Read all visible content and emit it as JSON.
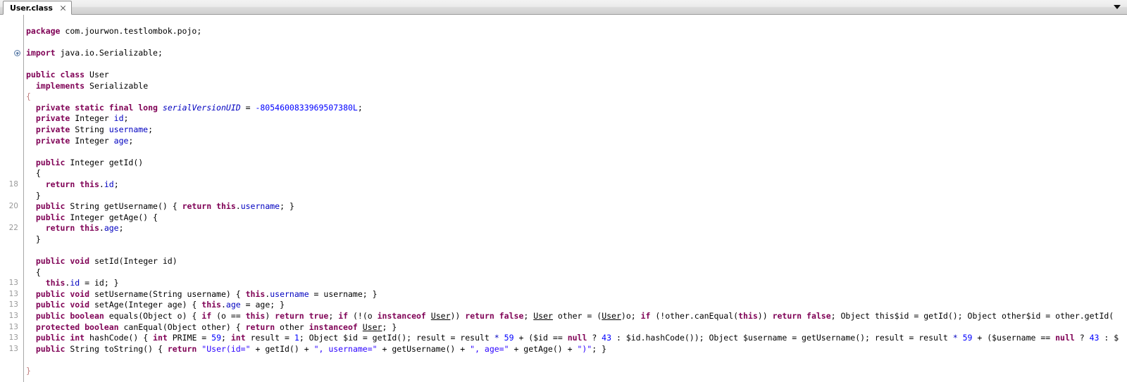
{
  "window": {
    "tab": {
      "label": "User.class",
      "close_icon": "close-icon"
    },
    "tab_menu_icon": "chevron-down-icon"
  },
  "editor": {
    "language": "java",
    "colors": {
      "keyword": "#7f0055",
      "field": "#0000c0",
      "number": "#0000ff",
      "string": "#2a00ff",
      "static_field": "#0000c0",
      "brace_highlight": "#c07f7f",
      "gutter_text": "#999999",
      "background": "#ffffff"
    },
    "lines": [
      {
        "num": "",
        "fold": false,
        "tokens": []
      },
      {
        "num": "",
        "fold": false,
        "tokens": [
          {
            "t": "kw",
            "s": "package"
          },
          {
            "t": "plain",
            "s": " com.jourwon.testlombok.pojo;"
          }
        ]
      },
      {
        "num": "",
        "fold": false,
        "tokens": []
      },
      {
        "num": "",
        "fold": true,
        "tokens": [
          {
            "t": "kw",
            "s": "import"
          },
          {
            "t": "plain",
            "s": " java.io.Serializable;"
          }
        ]
      },
      {
        "num": "",
        "fold": false,
        "tokens": []
      },
      {
        "num": "",
        "fold": false,
        "tokens": [
          {
            "t": "kw",
            "s": "public class"
          },
          {
            "t": "plain",
            "s": " User"
          }
        ]
      },
      {
        "num": "",
        "fold": false,
        "tokens": [
          {
            "t": "plain",
            "s": "  "
          },
          {
            "t": "kw",
            "s": "implements"
          },
          {
            "t": "plain",
            "s": " Serializable"
          }
        ]
      },
      {
        "num": "",
        "fold": false,
        "tokens": [
          {
            "t": "rbrace",
            "s": "{"
          }
        ]
      },
      {
        "num": "",
        "fold": false,
        "tokens": [
          {
            "t": "plain",
            "s": "  "
          },
          {
            "t": "kw",
            "s": "private static final long"
          },
          {
            "t": "plain",
            "s": " "
          },
          {
            "t": "stat",
            "s": "serialVersionUID"
          },
          {
            "t": "plain",
            "s": " = "
          },
          {
            "t": "num",
            "s": "-8054600833969507380L"
          },
          {
            "t": "plain",
            "s": ";"
          }
        ]
      },
      {
        "num": "",
        "fold": false,
        "tokens": [
          {
            "t": "plain",
            "s": "  "
          },
          {
            "t": "kw",
            "s": "private"
          },
          {
            "t": "plain",
            "s": " Integer "
          },
          {
            "t": "fld",
            "s": "id"
          },
          {
            "t": "plain",
            "s": ";"
          }
        ]
      },
      {
        "num": "",
        "fold": false,
        "tokens": [
          {
            "t": "plain",
            "s": "  "
          },
          {
            "t": "kw",
            "s": "private"
          },
          {
            "t": "plain",
            "s": " String "
          },
          {
            "t": "fld",
            "s": "username"
          },
          {
            "t": "plain",
            "s": ";"
          }
        ]
      },
      {
        "num": "",
        "fold": false,
        "tokens": [
          {
            "t": "plain",
            "s": "  "
          },
          {
            "t": "kw",
            "s": "private"
          },
          {
            "t": "plain",
            "s": " Integer "
          },
          {
            "t": "fld",
            "s": "age"
          },
          {
            "t": "plain",
            "s": ";"
          }
        ]
      },
      {
        "num": "",
        "fold": false,
        "tokens": []
      },
      {
        "num": "",
        "fold": false,
        "tokens": [
          {
            "t": "plain",
            "s": "  "
          },
          {
            "t": "kw",
            "s": "public"
          },
          {
            "t": "plain",
            "s": " Integer getId()"
          }
        ]
      },
      {
        "num": "",
        "fold": false,
        "tokens": [
          {
            "t": "plain",
            "s": "  {"
          }
        ]
      },
      {
        "num": "18",
        "fold": false,
        "tokens": [
          {
            "t": "plain",
            "s": "    "
          },
          {
            "t": "kw",
            "s": "return"
          },
          {
            "t": "plain",
            "s": " "
          },
          {
            "t": "kw",
            "s": "this"
          },
          {
            "t": "plain",
            "s": "."
          },
          {
            "t": "fld",
            "s": "id"
          },
          {
            "t": "plain",
            "s": ";"
          }
        ]
      },
      {
        "num": "",
        "fold": false,
        "tokens": [
          {
            "t": "plain",
            "s": "  }"
          }
        ]
      },
      {
        "num": "20",
        "fold": false,
        "tokens": [
          {
            "t": "plain",
            "s": "  "
          },
          {
            "t": "kw",
            "s": "public"
          },
          {
            "t": "plain",
            "s": " String getUsername() { "
          },
          {
            "t": "kw",
            "s": "return"
          },
          {
            "t": "plain",
            "s": " "
          },
          {
            "t": "kw",
            "s": "this"
          },
          {
            "t": "plain",
            "s": "."
          },
          {
            "t": "fld",
            "s": "username"
          },
          {
            "t": "plain",
            "s": "; }"
          }
        ]
      },
      {
        "num": "",
        "fold": false,
        "tokens": [
          {
            "t": "plain",
            "s": "  "
          },
          {
            "t": "kw",
            "s": "public"
          },
          {
            "t": "plain",
            "s": " Integer getAge() {"
          }
        ]
      },
      {
        "num": "22",
        "fold": false,
        "tokens": [
          {
            "t": "plain",
            "s": "    "
          },
          {
            "t": "kw",
            "s": "return"
          },
          {
            "t": "plain",
            "s": " "
          },
          {
            "t": "kw",
            "s": "this"
          },
          {
            "t": "plain",
            "s": "."
          },
          {
            "t": "fld",
            "s": "age"
          },
          {
            "t": "plain",
            "s": ";"
          }
        ]
      },
      {
        "num": "",
        "fold": false,
        "tokens": [
          {
            "t": "plain",
            "s": "  }"
          }
        ]
      },
      {
        "num": "",
        "fold": false,
        "tokens": []
      },
      {
        "num": "",
        "fold": false,
        "tokens": [
          {
            "t": "plain",
            "s": "  "
          },
          {
            "t": "kw",
            "s": "public void"
          },
          {
            "t": "plain",
            "s": " setId(Integer id)"
          }
        ]
      },
      {
        "num": "",
        "fold": false,
        "tokens": [
          {
            "t": "plain",
            "s": "  {"
          }
        ]
      },
      {
        "num": "13",
        "fold": false,
        "tokens": [
          {
            "t": "plain",
            "s": "    "
          },
          {
            "t": "kw",
            "s": "this"
          },
          {
            "t": "plain",
            "s": "."
          },
          {
            "t": "fld",
            "s": "id"
          },
          {
            "t": "plain",
            "s": " = id; }"
          }
        ]
      },
      {
        "num": "13",
        "fold": false,
        "tokens": [
          {
            "t": "plain",
            "s": "  "
          },
          {
            "t": "kw",
            "s": "public void"
          },
          {
            "t": "plain",
            "s": " setUsername(String username) { "
          },
          {
            "t": "kw",
            "s": "this"
          },
          {
            "t": "plain",
            "s": "."
          },
          {
            "t": "fld",
            "s": "username"
          },
          {
            "t": "plain",
            "s": " = username; }"
          }
        ]
      },
      {
        "num": "13",
        "fold": false,
        "tokens": [
          {
            "t": "plain",
            "s": "  "
          },
          {
            "t": "kw",
            "s": "public void"
          },
          {
            "t": "plain",
            "s": " setAge(Integer age) { "
          },
          {
            "t": "kw",
            "s": "this"
          },
          {
            "t": "plain",
            "s": "."
          },
          {
            "t": "fld",
            "s": "age"
          },
          {
            "t": "plain",
            "s": " = age; }"
          }
        ]
      },
      {
        "num": "13",
        "fold": false,
        "tokens": [
          {
            "t": "plain",
            "s": "  "
          },
          {
            "t": "kw",
            "s": "public boolean"
          },
          {
            "t": "plain",
            "s": " equals(Object o) { "
          },
          {
            "t": "kw",
            "s": "if"
          },
          {
            "t": "plain",
            "s": " (o == "
          },
          {
            "t": "kw",
            "s": "this"
          },
          {
            "t": "plain",
            "s": ") "
          },
          {
            "t": "kw",
            "s": "return true"
          },
          {
            "t": "plain",
            "s": "; "
          },
          {
            "t": "kw",
            "s": "if"
          },
          {
            "t": "plain",
            "s": " (!(o "
          },
          {
            "t": "kw",
            "s": "instanceof"
          },
          {
            "t": "plain",
            "s": " "
          },
          {
            "t": "typ",
            "s": "User"
          },
          {
            "t": "plain",
            "s": ")) "
          },
          {
            "t": "kw",
            "s": "return false"
          },
          {
            "t": "plain",
            "s": "; "
          },
          {
            "t": "typ",
            "s": "User"
          },
          {
            "t": "plain",
            "s": " other = ("
          },
          {
            "t": "typ",
            "s": "User"
          },
          {
            "t": "plain",
            "s": ")o; "
          },
          {
            "t": "kw",
            "s": "if"
          },
          {
            "t": "plain",
            "s": " (!other.canEqual("
          },
          {
            "t": "kw",
            "s": "this"
          },
          {
            "t": "plain",
            "s": ")) "
          },
          {
            "t": "kw",
            "s": "return false"
          },
          {
            "t": "plain",
            "s": "; Object this$id = getId(); Object other$id = other.getId("
          }
        ]
      },
      {
        "num": "13",
        "fold": false,
        "tokens": [
          {
            "t": "plain",
            "s": "  "
          },
          {
            "t": "kw",
            "s": "protected boolean"
          },
          {
            "t": "plain",
            "s": " canEqual(Object other) { "
          },
          {
            "t": "kw",
            "s": "return"
          },
          {
            "t": "plain",
            "s": " other "
          },
          {
            "t": "kw",
            "s": "instanceof"
          },
          {
            "t": "plain",
            "s": " "
          },
          {
            "t": "typ",
            "s": "User"
          },
          {
            "t": "plain",
            "s": "; }"
          }
        ]
      },
      {
        "num": "13",
        "fold": false,
        "tokens": [
          {
            "t": "plain",
            "s": "  "
          },
          {
            "t": "kw",
            "s": "public int"
          },
          {
            "t": "plain",
            "s": " hashCode() { "
          },
          {
            "t": "kw",
            "s": "int"
          },
          {
            "t": "plain",
            "s": " PRIME = "
          },
          {
            "t": "num",
            "s": "59"
          },
          {
            "t": "plain",
            "s": "; "
          },
          {
            "t": "kw",
            "s": "int"
          },
          {
            "t": "plain",
            "s": " result = "
          },
          {
            "t": "num",
            "s": "1"
          },
          {
            "t": "plain",
            "s": "; Object $id = getId(); result = result "
          },
          {
            "t": "stat",
            "s": "*"
          },
          {
            "t": "plain",
            "s": " "
          },
          {
            "t": "num",
            "s": "59"
          },
          {
            "t": "plain",
            "s": " + ($id == "
          },
          {
            "t": "kw",
            "s": "null"
          },
          {
            "t": "plain",
            "s": " ? "
          },
          {
            "t": "num",
            "s": "43"
          },
          {
            "t": "plain",
            "s": " : $id.hashCode()); Object $username = getUsername(); result = result "
          },
          {
            "t": "stat",
            "s": "*"
          },
          {
            "t": "plain",
            "s": " "
          },
          {
            "t": "num",
            "s": "59"
          },
          {
            "t": "plain",
            "s": " + ($username == "
          },
          {
            "t": "kw",
            "s": "null"
          },
          {
            "t": "plain",
            "s": " ? "
          },
          {
            "t": "num",
            "s": "43"
          },
          {
            "t": "plain",
            "s": " : $"
          }
        ]
      },
      {
        "num": "13",
        "fold": false,
        "tokens": [
          {
            "t": "plain",
            "s": "  "
          },
          {
            "t": "kw",
            "s": "public"
          },
          {
            "t": "plain",
            "s": " String toString() { "
          },
          {
            "t": "kw",
            "s": "return"
          },
          {
            "t": "plain",
            "s": " "
          },
          {
            "t": "str",
            "s": "\"User(id=\""
          },
          {
            "t": "plain",
            "s": " + getId() + "
          },
          {
            "t": "str",
            "s": "\", username=\""
          },
          {
            "t": "plain",
            "s": " + getUsername() + "
          },
          {
            "t": "str",
            "s": "\", age=\""
          },
          {
            "t": "plain",
            "s": " + getAge() + "
          },
          {
            "t": "str",
            "s": "\")\""
          },
          {
            "t": "plain",
            "s": "; }"
          }
        ]
      },
      {
        "num": "",
        "fold": false,
        "tokens": []
      },
      {
        "num": "",
        "fold": false,
        "tokens": [
          {
            "t": "rbrace",
            "s": "}"
          }
        ]
      }
    ]
  }
}
